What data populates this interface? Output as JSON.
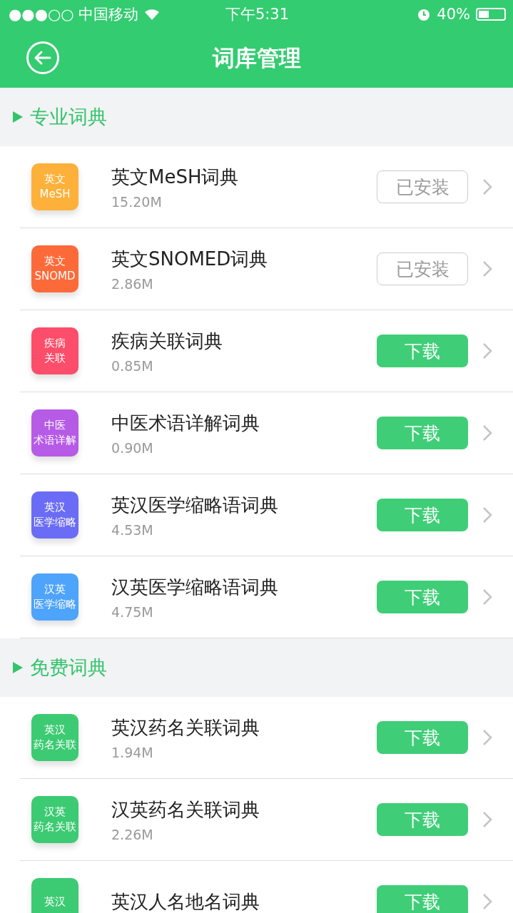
{
  "status_bar": {
    "carrier": "●●●○○ 中国移动",
    "time": "下午5:31",
    "battery": "40%"
  },
  "header": {
    "title": "词库管理"
  },
  "sections": [
    {
      "title": "专业词典",
      "items": [
        {
          "icon_lines": [
            "英文",
            "MeSH"
          ],
          "color": "#fdb13a",
          "name": "英文MeSH词典",
          "size": "15.20M",
          "action": {
            "kind": "installed",
            "label": "已安装"
          }
        },
        {
          "icon_lines": [
            "英文",
            "SNOMD"
          ],
          "color": "#fd6a3a",
          "name": "英文SNOMED词典",
          "size": "2.86M",
          "action": {
            "kind": "installed",
            "label": "已安装"
          }
        },
        {
          "icon_lines": [
            "疾病",
            "关联"
          ],
          "color": "#fc4d6a",
          "name": "疾病关联词典",
          "size": "0.85M",
          "action": {
            "kind": "download",
            "label": "下载"
          }
        },
        {
          "icon_lines": [
            "中医",
            "术语详解"
          ],
          "color": "#b65be6",
          "name": "中医术语详解词典",
          "size": "0.90M",
          "action": {
            "kind": "download",
            "label": "下载"
          }
        },
        {
          "icon_lines": [
            "英汉",
            "医学缩略"
          ],
          "color": "#6b6cf5",
          "name": "英汉医学缩略语词典",
          "size": "4.53M",
          "action": {
            "kind": "download",
            "label": "下载"
          }
        },
        {
          "icon_lines": [
            "汉英",
            "医学缩略"
          ],
          "color": "#4ea3fb",
          "name": "汉英医学缩略语词典",
          "size": "4.75M",
          "action": {
            "kind": "download",
            "label": "下载"
          }
        }
      ]
    },
    {
      "title": "免费词典",
      "items": [
        {
          "icon_lines": [
            "英汉",
            "药名关联"
          ],
          "color": "#3ccb72",
          "name": "英汉药名关联词典",
          "size": "1.94M",
          "action": {
            "kind": "download",
            "label": "下载"
          }
        },
        {
          "icon_lines": [
            "汉英",
            "药名关联"
          ],
          "color": "#3ccb72",
          "name": "汉英药名关联词典",
          "size": "2.26M",
          "action": {
            "kind": "download",
            "label": "下载"
          }
        },
        {
          "icon_lines": [
            "英汉"
          ],
          "color": "#3ccb72",
          "name": "英汉人名地名词典",
          "action": {
            "kind": "download",
            "label": "下载"
          }
        }
      ]
    }
  ]
}
